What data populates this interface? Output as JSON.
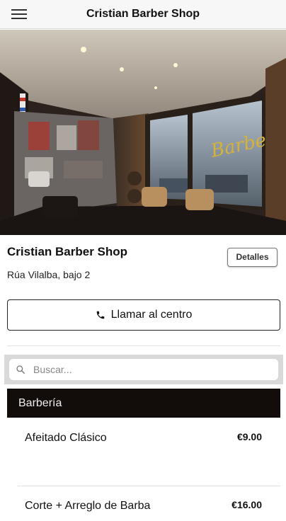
{
  "header": {
    "title": "Cristian Barber Shop",
    "menu_icon": "hamburger-menu-icon"
  },
  "shop": {
    "name": "Cristian Barber Shop",
    "address": "Rúa Vilalba, bajo 2",
    "details_label": "Detalles",
    "call_label": "Llamar al centro",
    "call_icon": "phone-icon"
  },
  "search": {
    "placeholder": "Buscar...",
    "value": "",
    "icon": "search-icon"
  },
  "category": {
    "name": "Barbería"
  },
  "services": [
    {
      "name": "Afeitado Clásico",
      "price": "€9.00"
    },
    {
      "name": "Corte + Arreglo de Barba",
      "price": "€16.00"
    }
  ],
  "colors": {
    "category_bg": "#120c0a",
    "header_bg": "#f7f7f7",
    "search_bar_bg": "#d9d9d9"
  }
}
